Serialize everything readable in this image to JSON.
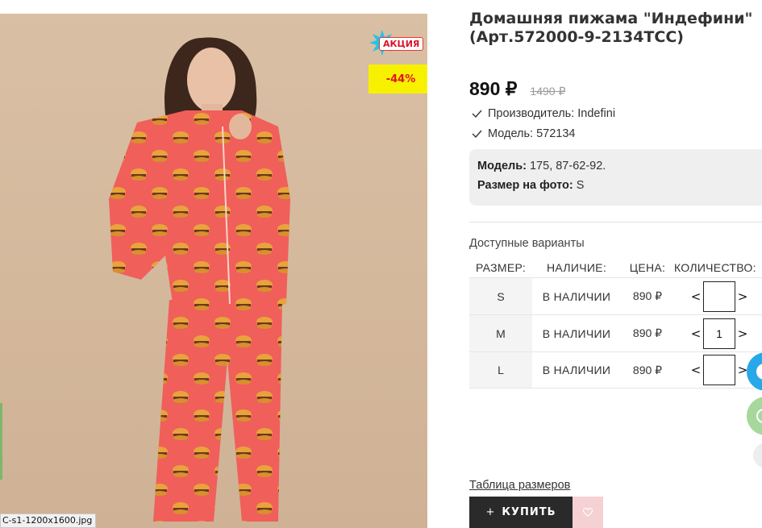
{
  "product": {
    "title": "Домашняя пижама \"Индефини\" (Арт.572000-9-2134ТСС)",
    "price": "890 ₽",
    "old_price": "1490 ₽",
    "properties": [
      {
        "text": "Производитель: Indefini"
      },
      {
        "text": "Модель: 572134"
      }
    ],
    "model_info": {
      "model_label": "Модель:",
      "model_value": " 175, 87-62-92.",
      "size_label": "Размер на фото:",
      "size_value": " S"
    }
  },
  "image": {
    "file_label": "C-s1-1200x1600.jpg",
    "promo_badge": "АКЦИЯ",
    "discount": "-44%"
  },
  "variants": {
    "title": "Доступные варианты",
    "headers": {
      "size": "РАЗМЕР:",
      "stock": "НАЛИЧИЕ:",
      "price": "ЦЕНА:",
      "qty": "КОЛИЧЕСТВО:"
    },
    "rows": [
      {
        "size": "S",
        "stock": "В НАЛИЧИИ",
        "price": "890 ₽",
        "qty": ""
      },
      {
        "size": "M",
        "stock": "В НАЛИЧИИ",
        "price": "890 ₽",
        "qty": "1"
      },
      {
        "size": "L",
        "stock": "В НАЛИЧИИ",
        "price": "890 ₽",
        "qty": ""
      }
    ],
    "decrement": "<",
    "increment": ">"
  },
  "actions": {
    "size_table_link": "Таблица размеров",
    "buy_plus": "+",
    "buy_label": "КУПИТЬ",
    "favorite_icon": "heart-icon"
  },
  "colors": {
    "discount_bg": "#f7f100",
    "discount_text": "#e1131d",
    "buy_bg": "#2a2a2a",
    "favorite_bg": "#f6d1d3",
    "telegram": "#28a8e9",
    "whatsapp": "#a6d89c"
  }
}
